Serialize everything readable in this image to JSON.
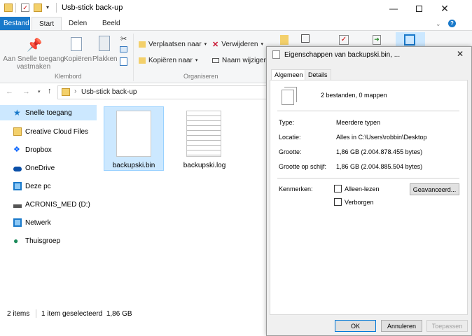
{
  "window": {
    "title": "Usb-stick back-up"
  },
  "ribbon": {
    "tabs": [
      "Bestand",
      "Start",
      "Delen",
      "Beeld"
    ],
    "pin_label": "Aan Snelle toegang vastmaken",
    "copy_label": "Kopiëren",
    "paste_label": "Plakken",
    "group_clipboard": "Klembord",
    "move_to": "Verplaatsen naar",
    "copy_to": "Kopiëren naar",
    "delete": "Verwijderen",
    "rename": "Naam wijzigen",
    "group_organize": "Organiseren"
  },
  "address": {
    "path": "Usb-stick back-up"
  },
  "sidebar": {
    "items": [
      "Snelle toegang",
      "Creative Cloud Files",
      "Dropbox",
      "OneDrive",
      "Deze pc",
      "ACRONIS_MED (D:)",
      "Netwerk",
      "Thuisgroep"
    ]
  },
  "files": [
    {
      "name": "backupski.bin"
    },
    {
      "name": "backupski.log"
    }
  ],
  "status": {
    "items": "2 items",
    "selected": "1 item geselecteerd  1,86 GB"
  },
  "dialog": {
    "title": "Eigenschappen van backupski.bin, ...",
    "tabs": [
      "Algemeen",
      "Details"
    ],
    "summary": "2 bestanden, 0 mappen",
    "type_label": "Type:",
    "type_value": "Meerdere typen",
    "location_label": "Locatie:",
    "location_value": "Alles in C:\\Users\\robbin\\Desktop",
    "size_label": "Grootte:",
    "size_value": "1,86 GB (2.004.878.455 bytes)",
    "disk_label": "Grootte op schijf:",
    "disk_value": "1,86 GB (2.004.885.504 bytes)",
    "attributes_label": "Kenmerken:",
    "readonly_label": "Alleen-lezen",
    "hidden_label": "Verborgen",
    "advanced_button": "Geavanceerd...",
    "ok_button": "OK",
    "cancel_button": "Annuleren",
    "apply_button": "Toepassen"
  },
  "colors": {
    "accent": "#1979ca",
    "selection": "#cce8ff"
  }
}
